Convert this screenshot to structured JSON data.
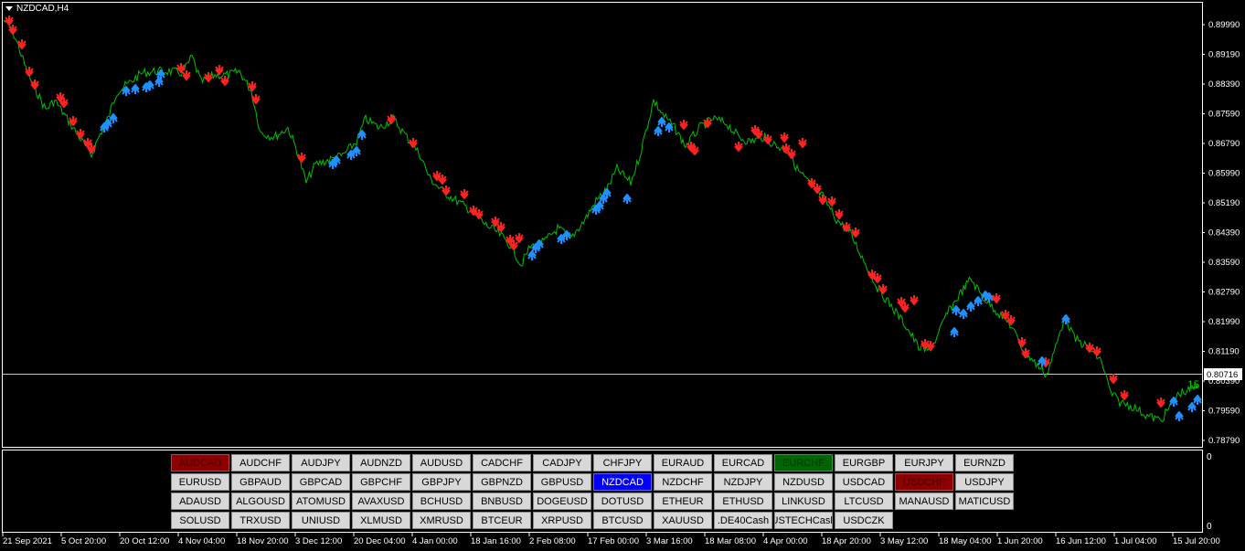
{
  "chart": {
    "symbol_title": "NZDCAD,H4",
    "current_price": "0.80716",
    "last_price_label": "15",
    "y_ticks": [
      "0.89990",
      "0.89190",
      "0.88390",
      "0.87590",
      "0.86790",
      "0.85990",
      "0.85190",
      "0.84390",
      "0.83590",
      "0.82790",
      "0.81990",
      "0.81190",
      "0.80390",
      "0.79590",
      "0.78790"
    ],
    "sub_ticks": [
      "0",
      "0"
    ],
    "x_ticks": [
      "21 Sep 2021",
      "5 Oct 20:00",
      "20 Oct 12:00",
      "4 Nov 04:00",
      "18 Nov 20:00",
      "3 Dec 12:00",
      "20 Dec 04:00",
      "4 Jan 00:00",
      "18 Jan 16:00",
      "2 Feb 08:00",
      "17 Feb 00:00",
      "3 Mar 16:00",
      "18 Mar 08:00",
      "4 Apr 00:00",
      "18 Apr 20:00",
      "3 May 12:00",
      "18 May 04:00",
      "1 Jun 20:00",
      "16 Jun 12:00",
      "1 Jul 04:00",
      "15 Jul 20:00"
    ],
    "colors": {
      "line": "#00c000",
      "sell": "#ff2020",
      "buy": "#1e90ff",
      "frame": "#ffffff"
    }
  },
  "symbols": [
    {
      "label": "AUDCAD",
      "state": "red"
    },
    {
      "label": "AUDCHF",
      "state": ""
    },
    {
      "label": "AUDJPY",
      "state": ""
    },
    {
      "label": "AUDNZD",
      "state": ""
    },
    {
      "label": "AUDUSD",
      "state": ""
    },
    {
      "label": "CADCHF",
      "state": ""
    },
    {
      "label": "CADJPY",
      "state": ""
    },
    {
      "label": "CHFJPY",
      "state": ""
    },
    {
      "label": "EURAUD",
      "state": ""
    },
    {
      "label": "EURCAD",
      "state": ""
    },
    {
      "label": "EURCHF",
      "state": "green"
    },
    {
      "label": "EURGBP",
      "state": ""
    },
    {
      "label": "EURJPY",
      "state": ""
    },
    {
      "label": "EURNZD",
      "state": ""
    },
    {
      "label": "EURUSD",
      "state": ""
    },
    {
      "label": "GBPAUD",
      "state": ""
    },
    {
      "label": "GBPCAD",
      "state": ""
    },
    {
      "label": "GBPCHF",
      "state": ""
    },
    {
      "label": "GBPJPY",
      "state": ""
    },
    {
      "label": "GBPNZD",
      "state": ""
    },
    {
      "label": "GBPUSD",
      "state": ""
    },
    {
      "label": "NZDCAD",
      "state": "blue"
    },
    {
      "label": "NZDCHF",
      "state": ""
    },
    {
      "label": "NZDJPY",
      "state": ""
    },
    {
      "label": "NZDUSD",
      "state": ""
    },
    {
      "label": "USDCAD",
      "state": ""
    },
    {
      "label": "USDCHF",
      "state": "red"
    },
    {
      "label": "USDJPY",
      "state": ""
    },
    {
      "label": "ADAUSD",
      "state": ""
    },
    {
      "label": "ALGOUSD",
      "state": ""
    },
    {
      "label": "ATOMUSD",
      "state": ""
    },
    {
      "label": "AVAXUSD",
      "state": ""
    },
    {
      "label": "BCHUSD",
      "state": ""
    },
    {
      "label": "BNBUSD",
      "state": ""
    },
    {
      "label": "DOGEUSD",
      "state": ""
    },
    {
      "label": "DOTUSD",
      "state": ""
    },
    {
      "label": "ETHEUR",
      "state": ""
    },
    {
      "label": "ETHUSD",
      "state": ""
    },
    {
      "label": "LINKUSD",
      "state": ""
    },
    {
      "label": "LTCUSD",
      "state": ""
    },
    {
      "label": "MANAUSD",
      "state": ""
    },
    {
      "label": "MATICUSD",
      "state": ""
    },
    {
      "label": "SOLUSD",
      "state": ""
    },
    {
      "label": "TRXUSD",
      "state": ""
    },
    {
      "label": "UNIUSD",
      "state": ""
    },
    {
      "label": "XLMUSD",
      "state": ""
    },
    {
      "label": "XMRUSD",
      "state": ""
    },
    {
      "label": "BTCEUR",
      "state": ""
    },
    {
      "label": "XRPUSD",
      "state": ""
    },
    {
      "label": "BTCUSD",
      "state": ""
    },
    {
      "label": "XAUUSD",
      "state": ""
    },
    {
      "label": ".DE40Cash",
      "state": ""
    },
    {
      "label": "USTECHCash",
      "state": ""
    },
    {
      "label": "USDCZK",
      "state": ""
    }
  ]
}
